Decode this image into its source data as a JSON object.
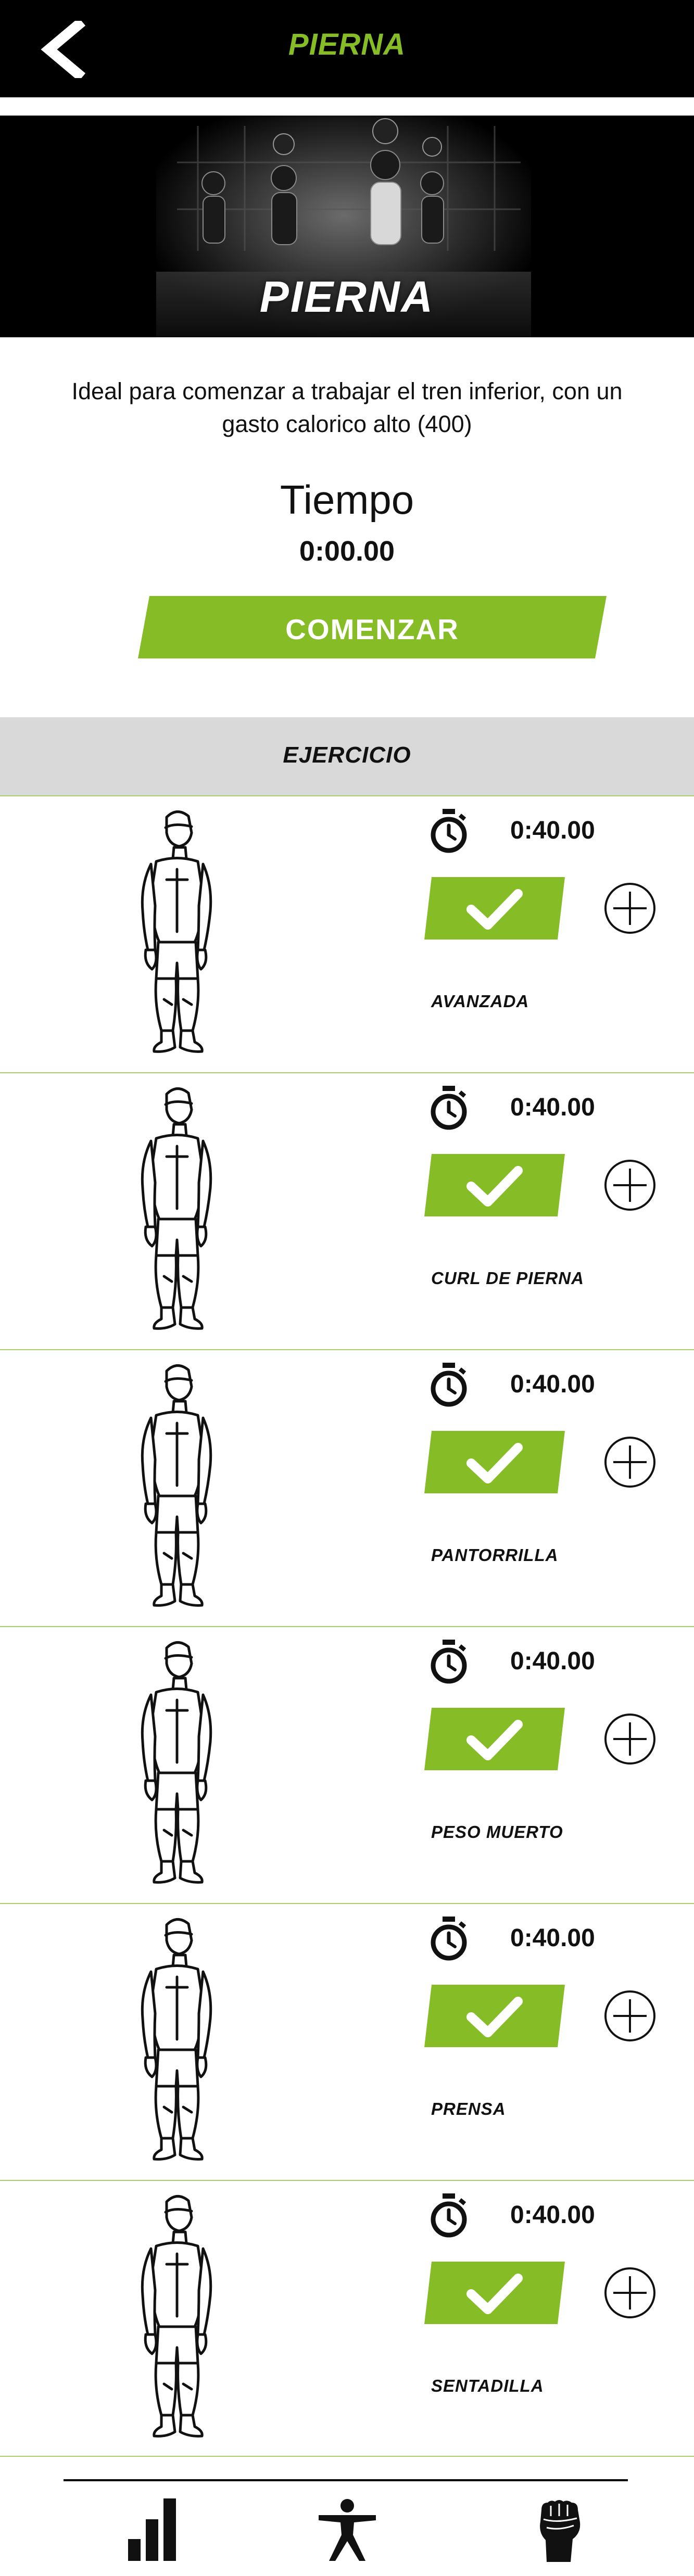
{
  "header": {
    "title": "PIERNA"
  },
  "hero": {
    "title": "PIERNA"
  },
  "description": "Ideal para comenzar a trabajar el tren inferior, con un gasto calorico alto (400)",
  "timer": {
    "label": "Tiempo",
    "value": "0:00.00"
  },
  "start_button": {
    "label": "COMENZAR"
  },
  "section": {
    "label": "EJERCICIO"
  },
  "exercises": [
    {
      "name": "AVANZADA",
      "time": "0:40.00"
    },
    {
      "name": "CURL DE PIERNA",
      "time": "0:40.00"
    },
    {
      "name": "PANTORRILLA",
      "time": "0:40.00"
    },
    {
      "name": "PESO MUERTO",
      "time": "0:40.00"
    },
    {
      "name": "PRENSA",
      "time": "0:40.00"
    },
    {
      "name": "SENTADILLA",
      "time": "0:40.00"
    }
  ],
  "bottom_nav": {
    "icons": [
      "stats-bars-icon",
      "body-figure-icon",
      "raised-fist-icon"
    ]
  },
  "colors": {
    "accent": "#86bc25",
    "header_bg": "#000000",
    "section_bg": "#d9d9d9"
  }
}
